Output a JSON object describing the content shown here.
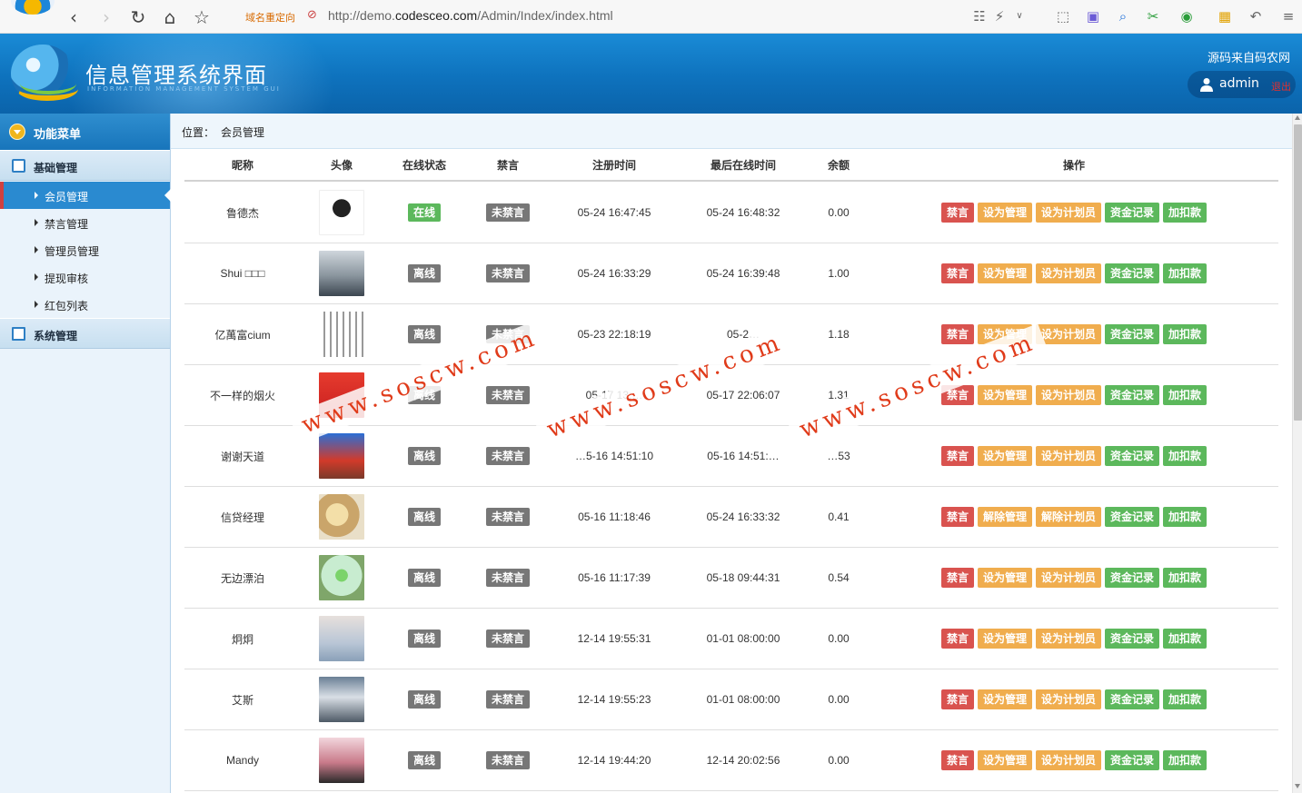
{
  "browser": {
    "redirect_label": "域名重定向",
    "url_prefix": "http://demo.",
    "url_domain": "codesceo.com",
    "url_path": "/Admin/Index/index.html"
  },
  "header": {
    "title": "信息管理系统界面",
    "subtitle": "INFORMATION MANAGEMENT SYSTEM GUI",
    "source_note": "源码来自码农网",
    "username": "admin",
    "logout": "退出"
  },
  "sidebar": {
    "title": "功能菜单",
    "groups": [
      {
        "label": "基础管理",
        "items": [
          {
            "label": "会员管理",
            "active": true
          },
          {
            "label": "禁言管理"
          },
          {
            "label": "管理员管理"
          },
          {
            "label": "提现审核"
          },
          {
            "label": "红包列表"
          }
        ]
      },
      {
        "label": "系统管理",
        "items": []
      }
    ]
  },
  "breadcrumb": {
    "label": "位置：",
    "current": "会员管理"
  },
  "table": {
    "columns": [
      "昵称",
      "头像",
      "在线状态",
      "禁言",
      "注册时间",
      "最后在线时间",
      "余额",
      "操作"
    ],
    "rows": [
      {
        "nick": "鲁德杰",
        "online": "在线",
        "mute": "未禁言",
        "reg": "05-24 16:47:45",
        "last": "05-24 16:48:32",
        "balance": "0.00",
        "ops": [
          "禁言",
          "设为管理",
          "设为计划员",
          "资金记录",
          "加扣款"
        ]
      },
      {
        "nick": "Shui □□□",
        "online": "离线",
        "mute": "未禁言",
        "reg": "05-24 16:33:29",
        "last": "05-24 16:39:48",
        "balance": "1.00",
        "ops": [
          "禁言",
          "设为管理",
          "设为计划员",
          "资金记录",
          "加扣款"
        ]
      },
      {
        "nick": "亿萬富cium",
        "online": "离线",
        "mute": "未禁言",
        "reg": "05-23 22:18:19",
        "last": "05-2…",
        "balance": "1.18",
        "ops": [
          "禁言",
          "设为管理",
          "设为计划员",
          "资金记录",
          "加扣款"
        ]
      },
      {
        "nick": "不一样的烟火",
        "online": "离线",
        "mute": "未禁言",
        "reg": "05-17 13:…",
        "last": "05-17 22:06:07",
        "balance": "1.31",
        "ops": [
          "禁言",
          "设为管理",
          "设为计划员",
          "资金记录",
          "加扣款"
        ]
      },
      {
        "nick": "谢谢天道",
        "online": "离线",
        "mute": "未禁言",
        "reg": "…5-16 14:51:10",
        "last": "05-16 14:51:…",
        "balance": "…53",
        "ops": [
          "禁言",
          "设为管理",
          "设为计划员",
          "资金记录",
          "加扣款"
        ]
      },
      {
        "nick": "信贷经理",
        "online": "离线",
        "mute": "未禁言",
        "reg": "05-16 11:18:46",
        "last": "05-24 16:33:32",
        "balance": "0.41",
        "ops": [
          "禁言",
          "解除管理",
          "解除计划员",
          "资金记录",
          "加扣款"
        ]
      },
      {
        "nick": "无边漂泊",
        "online": "离线",
        "mute": "未禁言",
        "reg": "05-16 11:17:39",
        "last": "05-18 09:44:31",
        "balance": "0.54",
        "ops": [
          "禁言",
          "设为管理",
          "设为计划员",
          "资金记录",
          "加扣款"
        ]
      },
      {
        "nick": "炯炯",
        "online": "离线",
        "mute": "未禁言",
        "reg": "12-14 19:55:31",
        "last": "01-01 08:00:00",
        "balance": "0.00",
        "ops": [
          "禁言",
          "设为管理",
          "设为计划员",
          "资金记录",
          "加扣款"
        ]
      },
      {
        "nick": "艾斯",
        "online": "离线",
        "mute": "未禁言",
        "reg": "12-14 19:55:23",
        "last": "01-01 08:00:00",
        "balance": "0.00",
        "ops": [
          "禁言",
          "设为管理",
          "设为计划员",
          "资金记录",
          "加扣款"
        ]
      },
      {
        "nick": "Mandy",
        "online": "离线",
        "mute": "未禁言",
        "reg": "12-14 19:44:20",
        "last": "12-14 20:02:56",
        "balance": "0.00",
        "ops": [
          "禁言",
          "设为管理",
          "设为计划员",
          "资金记录",
          "加扣款"
        ]
      }
    ]
  },
  "watermarks": [
    "www.soscw.com",
    "www.soscw.com",
    "www.soscw.com"
  ],
  "colors": {
    "header_blue": "#0e72bd",
    "online_green": "#5cb85c",
    "offline_gray": "#777777",
    "btn_red": "#d9534f",
    "btn_orange": "#f0ad4e",
    "btn_green": "#5cb85c"
  }
}
